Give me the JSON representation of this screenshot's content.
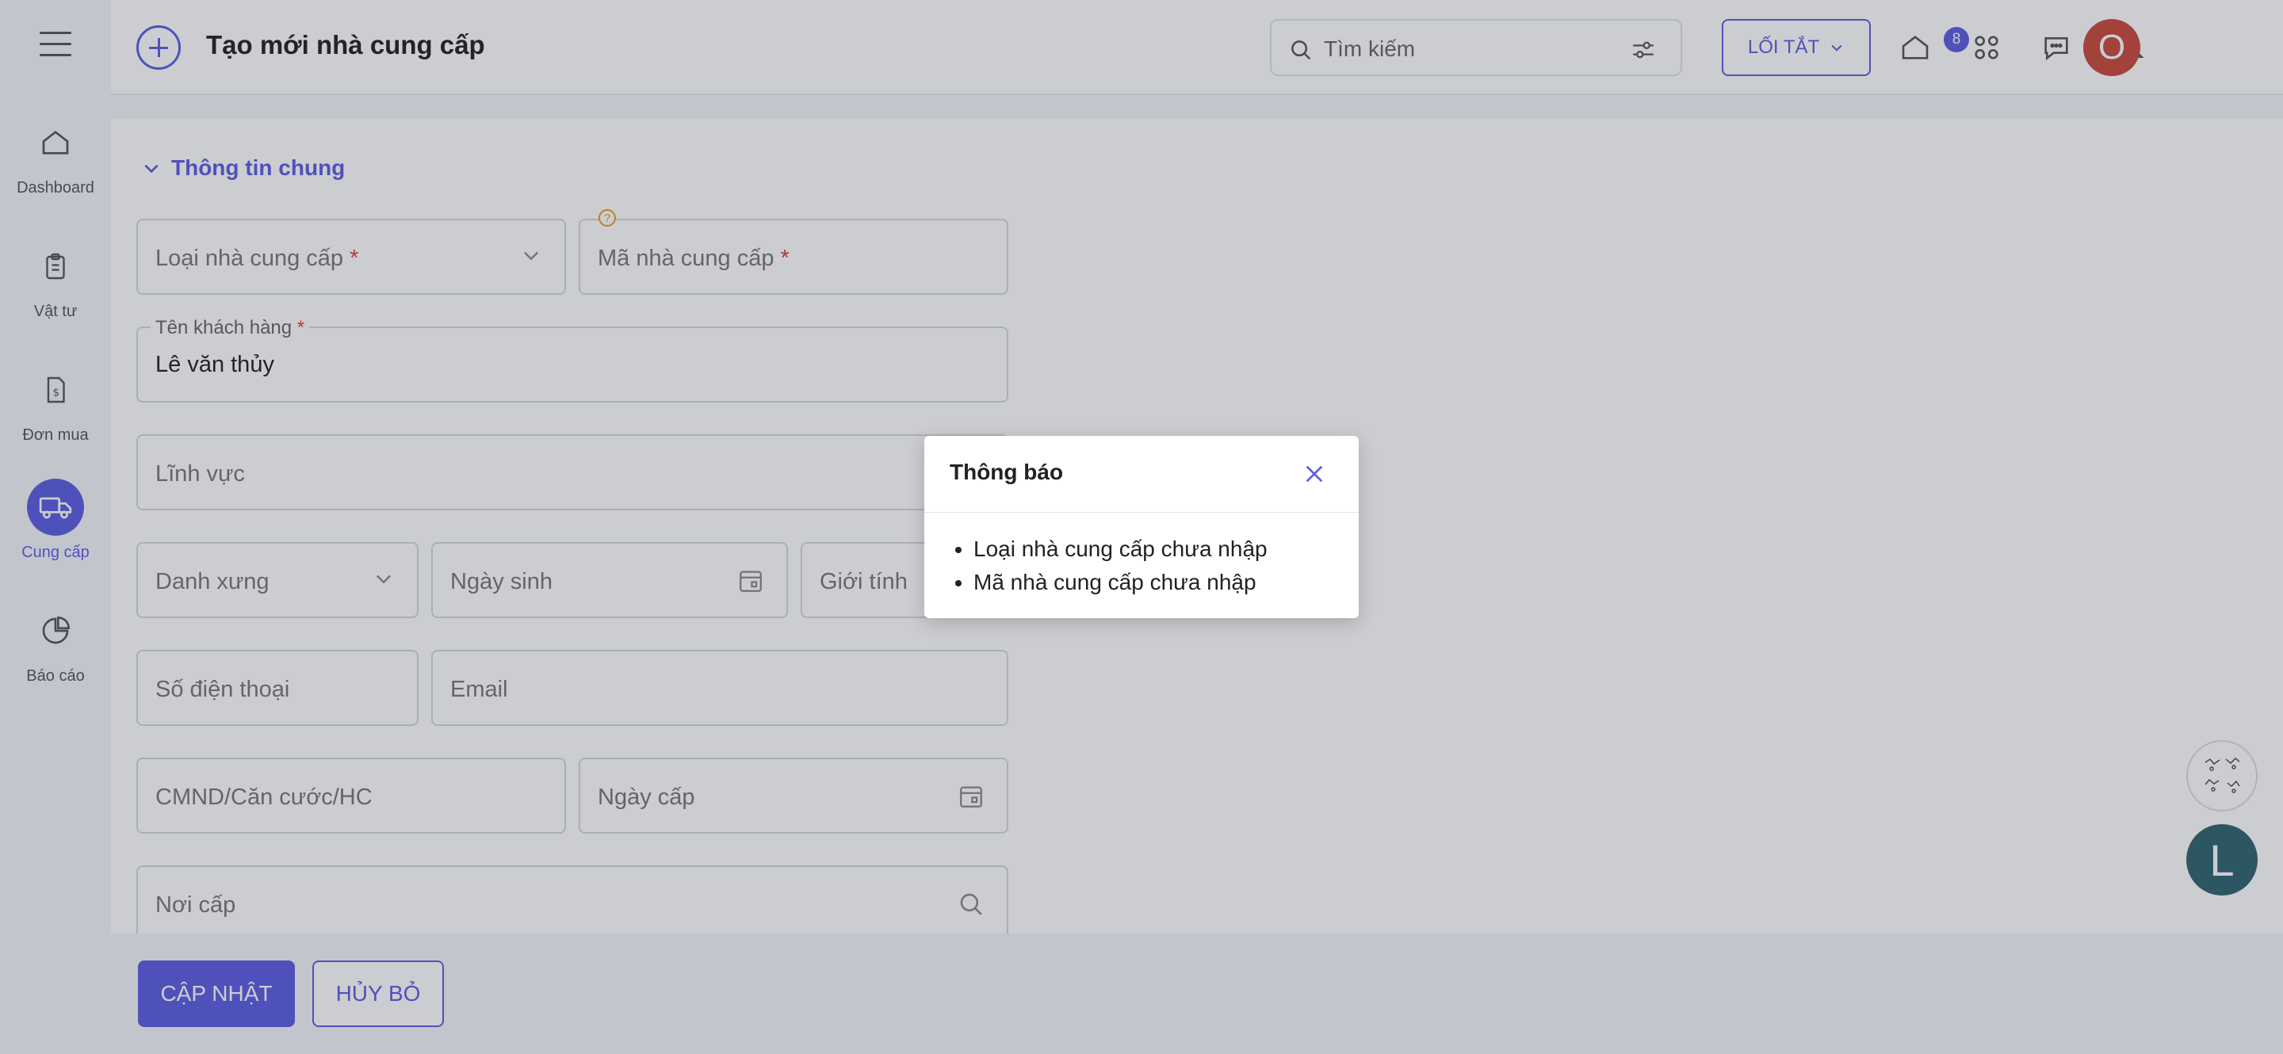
{
  "sidebar": {
    "items": [
      {
        "label": "Dashboard",
        "icon": "home-icon"
      },
      {
        "label": "Vật tư",
        "icon": "clipboard-icon"
      },
      {
        "label": "Đơn mua",
        "icon": "dollar-file-icon"
      },
      {
        "label": "Cung cấp",
        "icon": "truck-icon",
        "active": true
      },
      {
        "label": "Báo cáo",
        "icon": "pie-chart-icon"
      }
    ]
  },
  "header": {
    "title": "Tạo mới nhà cung cấp",
    "search_placeholder": "Tìm kiếm",
    "shortcut_label": "LỐI TẮT",
    "chat_badge": "8",
    "user_initial": "O"
  },
  "form": {
    "section_title": "Thông tin chung",
    "supplier_type": {
      "label": "Loại nhà cung cấp",
      "required_mark": "*"
    },
    "supplier_code": {
      "label": "Mã nhà cung cấp",
      "required_mark": "*",
      "help_mark": "?"
    },
    "customer_name": {
      "label": "Tên khách hàng",
      "required_mark": "*",
      "value": "Lê văn thủy"
    },
    "field_area": {
      "label": "Lĩnh vực"
    },
    "salutation": {
      "label": "Danh xưng"
    },
    "birthday": {
      "label": "Ngày sinh"
    },
    "gender": {
      "label": "Giới tính"
    },
    "phone": {
      "label": "Số điện thoại"
    },
    "email": {
      "label": "Email"
    },
    "id_number": {
      "label": "CMND/Căn cước/HC"
    },
    "issue_date": {
      "label": "Ngày cấp"
    },
    "issue_place": {
      "label": "Nơi cấp"
    }
  },
  "actions": {
    "update_label": "CẬP NHẬT",
    "cancel_label": "HỦY BỎ"
  },
  "floating": {
    "assistant_initial": "L"
  },
  "modal": {
    "title": "Thông báo",
    "messages": [
      "Loại nhà cung cấp chưa nhập",
      "Mã nhà cung cấp chưa nhập"
    ]
  },
  "colors": {
    "accent": "#5b5ce2",
    "required": "#e23b3b",
    "user_avatar": "#c9473c",
    "assistant_avatar": "#2f6370"
  }
}
